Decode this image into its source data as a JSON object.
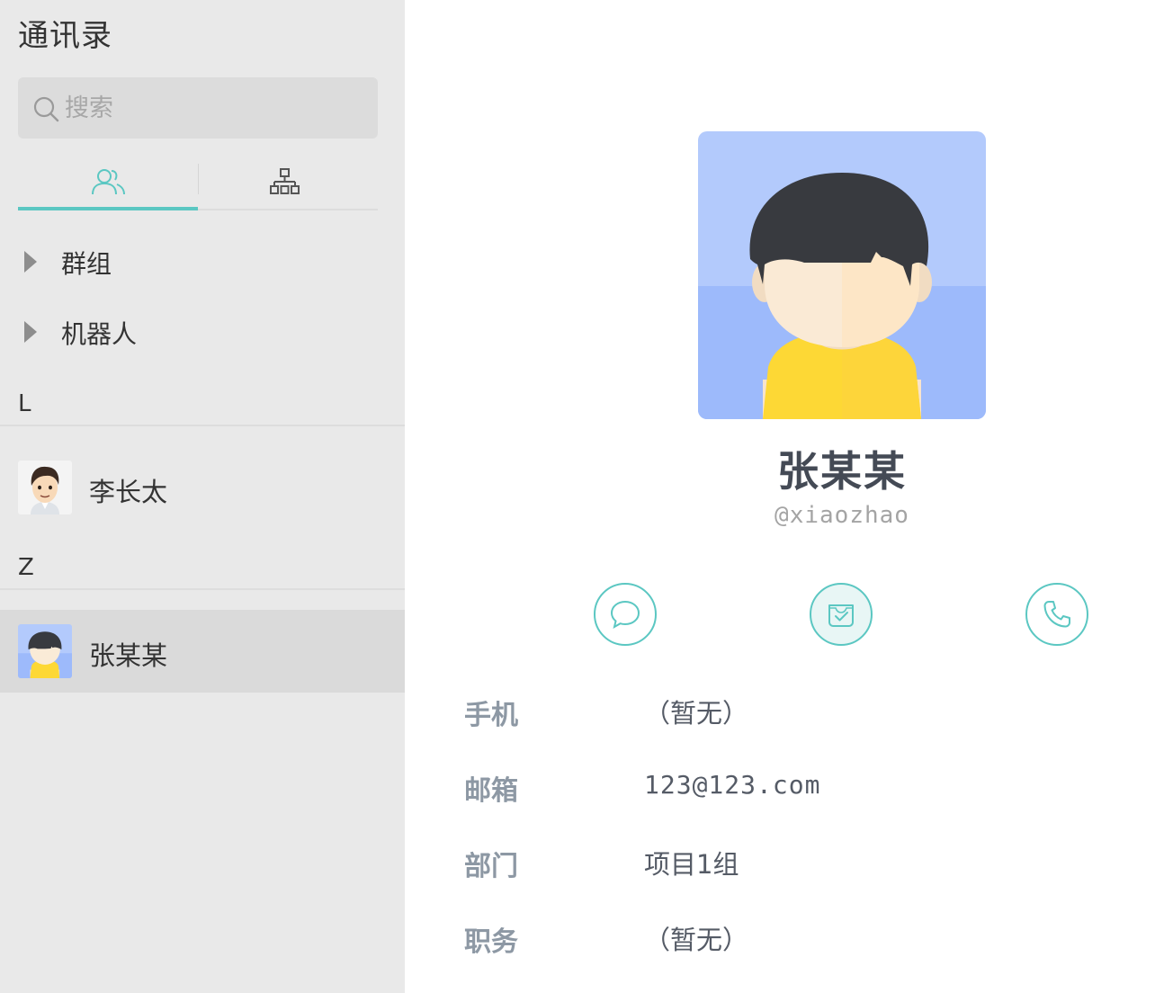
{
  "sidebar": {
    "title": "通讯录",
    "search": {
      "placeholder": "搜索",
      "icon": "search-icon"
    },
    "tabs": [
      {
        "name": "contacts",
        "icon": "people-icon",
        "active": true
      },
      {
        "name": "organization",
        "icon": "org-chart-icon",
        "active": false
      }
    ],
    "groups": [
      {
        "label": "群组"
      },
      {
        "label": "机器人"
      }
    ],
    "sections": [
      {
        "letter": "L",
        "contacts": [
          {
            "name": "李长太",
            "avatar": "man-cartoon-avatar"
          }
        ]
      },
      {
        "letter": "Z",
        "contacts": [
          {
            "name": "张某某",
            "avatar": "boy-yellow-shirt-avatar",
            "selected": true
          }
        ]
      }
    ]
  },
  "detail": {
    "name": "张某某",
    "username": "@xiaozhao",
    "actions": [
      {
        "name": "message",
        "icon": "chat-bubble-icon"
      },
      {
        "name": "tasks",
        "icon": "inbox-check-icon"
      },
      {
        "name": "call",
        "icon": "phone-icon"
      }
    ],
    "fields": [
      {
        "label": "手机",
        "value": "（暂无）"
      },
      {
        "label": "邮箱",
        "value": "123@123.com"
      },
      {
        "label": "部门",
        "value": "项目1组"
      },
      {
        "label": "职务",
        "value": "（暂无）"
      }
    ]
  },
  "colors": {
    "accent": "#5bc7c2",
    "sidebar_bg": "#e9e9e9",
    "selected_bg": "#dadada",
    "label_gray": "#8d98a4",
    "avatar_bg": "#b3cafc",
    "shirt_yellow": "#fdd835"
  }
}
